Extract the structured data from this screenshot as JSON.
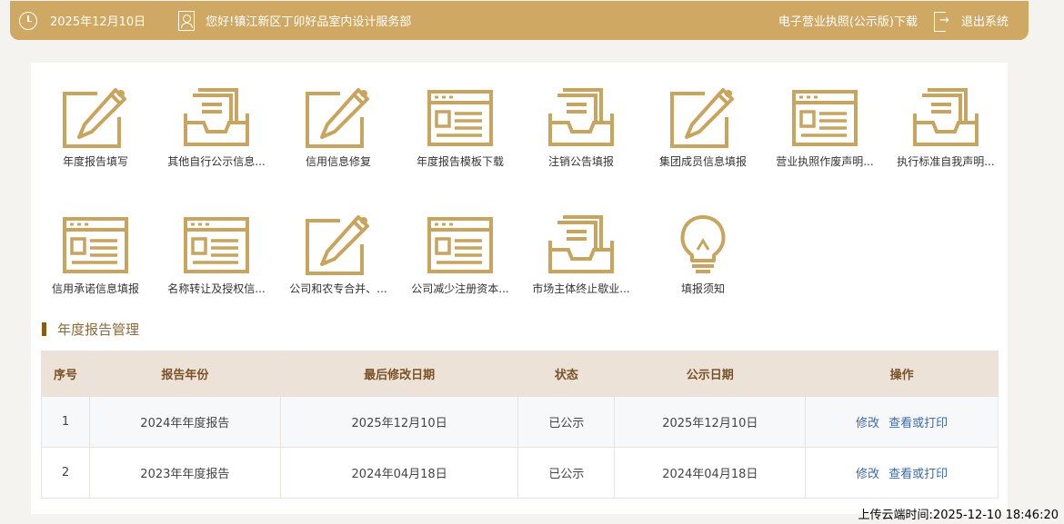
{
  "header": {
    "date": "2025年12月10日",
    "greeting": "您好!镇江新区丁卯好品室内设计服务部",
    "license_download": "电子营业执照(公示版)下载",
    "logout": "退出系统"
  },
  "tiles": [
    {
      "icon": "pencil-doc-icon",
      "label": "年度报告填写"
    },
    {
      "icon": "inbox-tray-icon",
      "label": "其他自行公示信息..."
    },
    {
      "icon": "pencil-doc-icon",
      "label": "信用信息修复"
    },
    {
      "icon": "form-window-icon",
      "label": "年度报告模板下载"
    },
    {
      "icon": "inbox-tray-icon",
      "label": "注销公告填报"
    },
    {
      "icon": "pencil-doc-icon",
      "label": "集团成员信息填报"
    },
    {
      "icon": "form-window-icon",
      "label": "营业执照作废声明..."
    },
    {
      "icon": "inbox-tray-icon",
      "label": "执行标准自我声明..."
    },
    {
      "icon": "form-window-icon",
      "label": "信用承诺信息填报"
    },
    {
      "icon": "form-window-icon",
      "label": "名称转让及授权信..."
    },
    {
      "icon": "pencil-doc-icon",
      "label": "公司和农专合并、..."
    },
    {
      "icon": "form-window-icon",
      "label": "公司减少注册资本..."
    },
    {
      "icon": "inbox-tray-icon",
      "label": "市场主体终止歇业..."
    },
    {
      "icon": "lightbulb-icon",
      "label": "填报须知"
    }
  ],
  "section": {
    "title": "年度报告管理"
  },
  "table": {
    "headers": [
      "序号",
      "报告年份",
      "最后修改日期",
      "状态",
      "公示日期",
      "操作"
    ],
    "rows": [
      {
        "no": "1",
        "year": "2024年年度报告",
        "modified": "2025年12月10日",
        "status": "已公示",
        "published": "2025年12月10日",
        "edit": "修改",
        "view": "查看或打印"
      },
      {
        "no": "2",
        "year": "2023年年度报告",
        "modified": "2024年04月18日",
        "status": "已公示",
        "published": "2024年04月18日",
        "edit": "修改",
        "view": "查看或打印"
      }
    ]
  },
  "footer": {
    "upload_time": "上传云端时间:2025-12-10 18:46:20"
  },
  "colors": {
    "accent": "#cfa963",
    "icon": "#c9a45e",
    "link": "#3a6ab0",
    "header_bg": "#ece2d8"
  }
}
